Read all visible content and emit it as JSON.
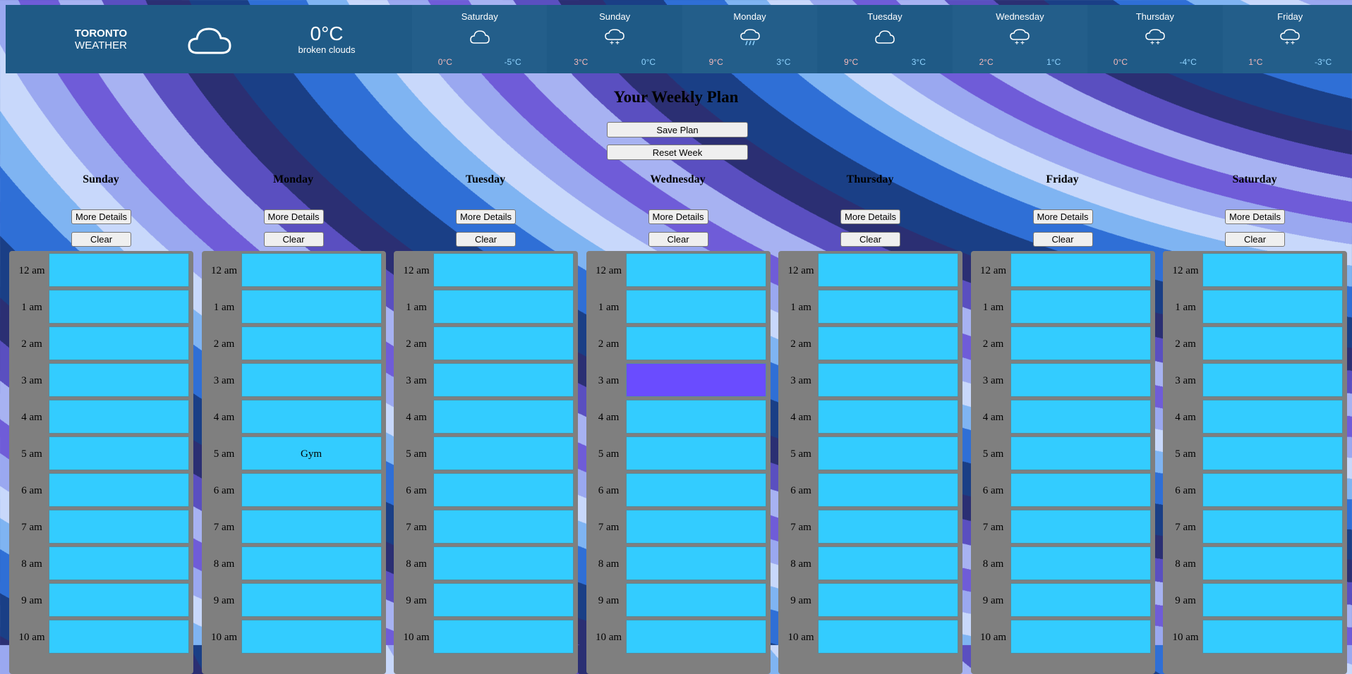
{
  "weather": {
    "city": "TORONTO",
    "label": "WEATHER",
    "current_icon": "cloud-icon",
    "current_temp": "0°C",
    "current_desc": "broken clouds",
    "forecast": [
      {
        "day": "Saturday",
        "icon": "cloud-icon",
        "hi": "0°C",
        "lo": "-5°C"
      },
      {
        "day": "Sunday",
        "icon": "snow-cloud-icon",
        "hi": "3°C",
        "lo": "0°C"
      },
      {
        "day": "Monday",
        "icon": "rain-cloud-icon",
        "hi": "9°C",
        "lo": "3°C"
      },
      {
        "day": "Tuesday",
        "icon": "cloud-icon",
        "hi": "9°C",
        "lo": "3°C"
      },
      {
        "day": "Wednesday",
        "icon": "snow-cloud-icon",
        "hi": "2°C",
        "lo": "1°C"
      },
      {
        "day": "Thursday",
        "icon": "snow-cloud-icon",
        "hi": "0°C",
        "lo": "-4°C"
      },
      {
        "day": "Friday",
        "icon": "snow-cloud-icon",
        "hi": "1°C",
        "lo": "-3°C"
      }
    ]
  },
  "plan": {
    "title": "Your Weekly Plan",
    "save_label": "Save Plan",
    "reset_label": "Reset Week",
    "details_label": "More Details",
    "clear_label": "Clear",
    "hours": [
      "12 am",
      "1 am",
      "2 am",
      "3 am",
      "4 am",
      "5 am",
      "6 am",
      "7 am",
      "8 am",
      "9 am",
      "10 am"
    ],
    "slot_color": "#33ccff",
    "busy_color": "#6a4cff",
    "days": [
      {
        "name": "Sunday",
        "slots": [
          "",
          "",
          "",
          "",
          "",
          "",
          "",
          "",
          "",
          "",
          ""
        ],
        "busy": []
      },
      {
        "name": "Monday",
        "slots": [
          "",
          "",
          "",
          "",
          "",
          "Gym",
          "",
          "",
          "",
          "",
          ""
        ],
        "busy": []
      },
      {
        "name": "Tuesday",
        "slots": [
          "",
          "",
          "",
          "",
          "",
          "",
          "",
          "",
          "",
          "",
          ""
        ],
        "busy": []
      },
      {
        "name": "Wednesday",
        "slots": [
          "",
          "",
          "",
          "",
          "",
          "",
          "",
          "",
          "",
          "",
          ""
        ],
        "busy": [
          3
        ]
      },
      {
        "name": "Thursday",
        "slots": [
          "",
          "",
          "",
          "",
          "",
          "",
          "",
          "",
          "",
          "",
          ""
        ],
        "busy": []
      },
      {
        "name": "Friday",
        "slots": [
          "",
          "",
          "",
          "",
          "",
          "",
          "",
          "",
          "",
          "",
          ""
        ],
        "busy": []
      },
      {
        "name": "Saturday",
        "slots": [
          "",
          "",
          "",
          "",
          "",
          "",
          "",
          "",
          "",
          "",
          ""
        ],
        "busy": []
      }
    ]
  }
}
